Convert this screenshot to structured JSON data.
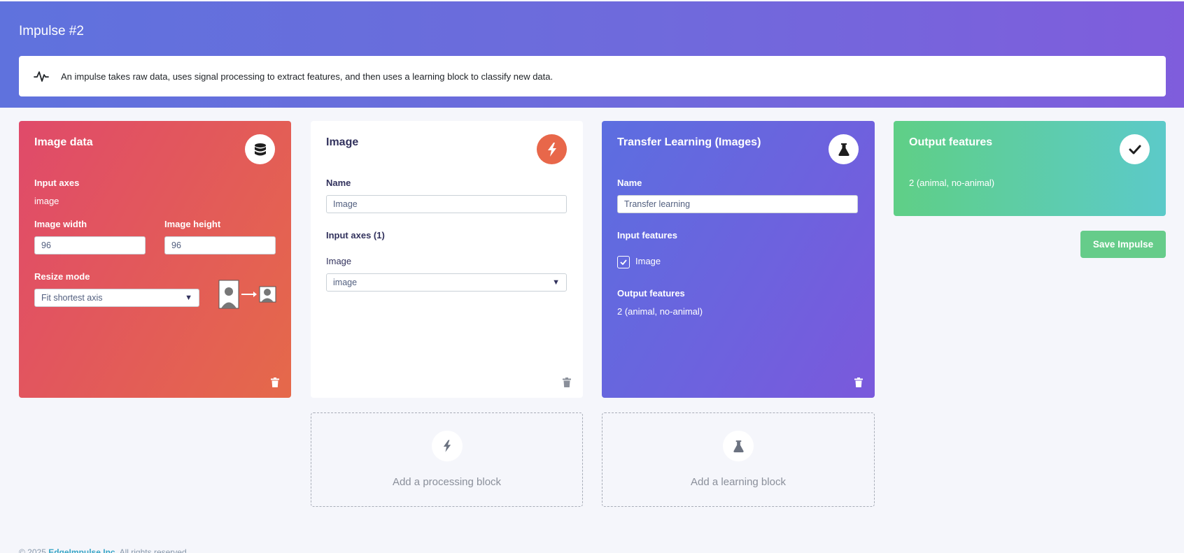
{
  "header": {
    "title": "Impulse #2",
    "info_text": "An impulse takes raw data, uses signal processing to extract features, and then uses a learning block to classify new data."
  },
  "input_block": {
    "title": "Image data",
    "input_axes_label": "Input axes",
    "input_axes_value": "image",
    "width_label": "Image width",
    "width_value": "96",
    "height_label": "Image height",
    "height_value": "96",
    "resize_mode_label": "Resize mode",
    "resize_mode_value": "Fit shortest axis"
  },
  "processing_block": {
    "title": "Image",
    "name_label": "Name",
    "name_value": "Image",
    "input_axes_label": "Input axes (1)",
    "axis_label": "Image",
    "axis_value": "image"
  },
  "learning_block": {
    "title": "Transfer Learning (Images)",
    "name_label": "Name",
    "name_value": "Transfer learning",
    "input_features_label": "Input features",
    "input_feature_item": "Image",
    "output_features_label": "Output features",
    "output_features_value": "2 (animal, no-animal)"
  },
  "output_block": {
    "title": "Output features",
    "value": "2 (animal, no-animal)"
  },
  "add_processing": {
    "label": "Add a processing block"
  },
  "add_learning": {
    "label": "Add a learning block"
  },
  "save_button": "Save Impulse",
  "footer": {
    "prefix": "© 2025",
    "company": "EdgeImpulse Inc.",
    "suffix": "All rights reserved"
  },
  "colors": {
    "header_gradient_start": "#5f72dd",
    "header_gradient_end": "#7f5ddc",
    "input_card": "#e04a6a",
    "processing_badge": "#e8674a",
    "learning_card": "#6c63de",
    "output_card": "#5fcf86",
    "save_button": "#66cc8a"
  },
  "icons": {
    "info": "pulse-icon",
    "input": "database-icon",
    "processing": "bolt-icon",
    "learning": "flask-icon",
    "output": "check-icon",
    "delete": "trash-icon"
  }
}
